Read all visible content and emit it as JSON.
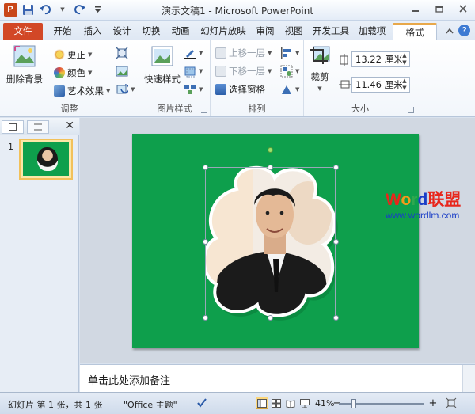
{
  "window": {
    "title": "演示文稿1 - Microsoft PowerPoint",
    "app_logo": "P",
    "controls": [
      "minimize-icon",
      "restore-icon",
      "close-icon"
    ]
  },
  "tabs": {
    "file": "文件",
    "items": [
      "开始",
      "插入",
      "设计",
      "切换",
      "动画",
      "幻灯片放映",
      "审阅",
      "视图",
      "开发工具",
      "加载项"
    ],
    "active": "格式"
  },
  "ribbon": {
    "adjust": {
      "remove_bg": "删除背景",
      "correct": "更正",
      "color": "颜色",
      "artistic": "艺术效果",
      "name": "调整"
    },
    "picture_styles": {
      "quick_styles": "快速样式",
      "name": "图片样式"
    },
    "arrange": {
      "bring_forward": "上移一层",
      "send_backward": "下移一层",
      "selection_pane": "选择窗格",
      "name": "排列"
    },
    "size": {
      "crop": "裁剪",
      "height": "13.22 厘米",
      "width": "11.46 厘米",
      "name": "大小"
    }
  },
  "slides_panel": {
    "close": "✕",
    "slide_number": "1"
  },
  "watermark": {
    "w": "W",
    "o": "o",
    "r": "r",
    "d": "d",
    "cn": "联盟",
    "url": "www.wordlm.com"
  },
  "notes": {
    "placeholder": "单击此处添加备注"
  },
  "status": {
    "slide_info": "幻灯片 第 1 张，共 1 张",
    "theme": "\"Office 主题\"",
    "zoom": "41%",
    "zoom_value": 41,
    "minus": "−",
    "plus": "+"
  },
  "colors": {
    "slide_bg": "#0e9f4c",
    "file_tab": "#d24726",
    "wm_red": "#e8261c",
    "wm_orange": "#f29a1a",
    "wm_green": "#2fa84f",
    "wm_blue": "#1a3ec7"
  }
}
